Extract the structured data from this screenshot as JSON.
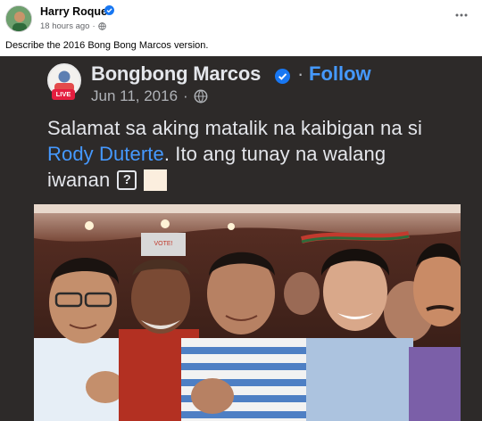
{
  "post": {
    "author": "Harry Roque",
    "timestamp": "18 hours ago",
    "separator": "·",
    "more_icon": "ellipsis-icon",
    "caption": "Describe the 2016 Bong Bong Marcos version."
  },
  "shared": {
    "author": "Bongbong Marcos",
    "separator": "·",
    "follow_label": "Follow",
    "date": "Jun 11, 2016",
    "date_separator": "·",
    "live_badge": "LIVE",
    "text_line1": "Salamat sa aking matalik na kaibigan na si",
    "mention": "Rody Duterte",
    "text_line2_rest": ". Ito ang tunay na walang",
    "text_line3": "iwanan",
    "qbox": "?",
    "photo_sign": "VOTE!"
  },
  "colors": {
    "verified": "#1877f2",
    "follow": "#4599ff",
    "screenshot_bg": "#2d2a29"
  }
}
